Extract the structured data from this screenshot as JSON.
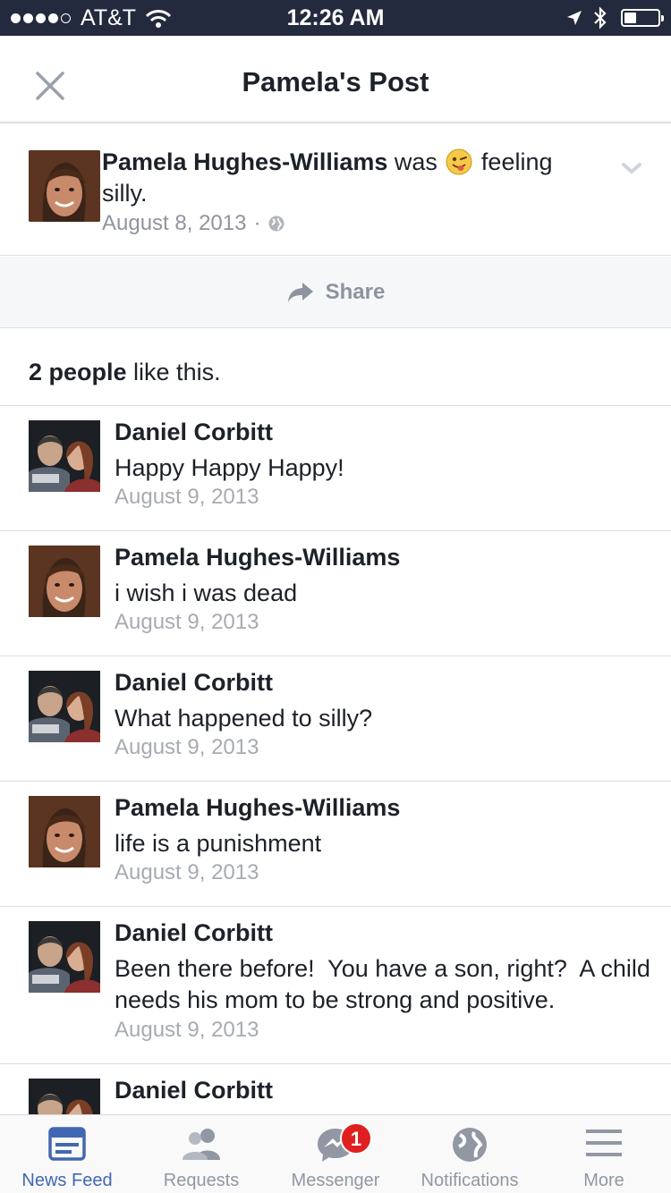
{
  "status_bar": {
    "carrier": "AT&T",
    "time": "12:26 AM",
    "signal_filled": 4,
    "signal_total": 5,
    "battery_level": 0.35
  },
  "header": {
    "title": "Pamela's Post"
  },
  "post": {
    "author": "Pamela Hughes-Williams",
    "was": "was",
    "feeling": "feeling",
    "mood": "silly.",
    "date": "August 8, 2013",
    "separator": "·",
    "emoji": "winking-tongue-emoji",
    "privacy_icon": "globe-icon"
  },
  "share": {
    "label": "Share"
  },
  "likes": {
    "count_text": "2 people",
    "suffix": "like this."
  },
  "comments": [
    {
      "author": "Daniel Corbitt",
      "text": "Happy Happy Happy!",
      "date": "August 9, 2013"
    },
    {
      "author": "Pamela Hughes-Williams",
      "text": "i wish i was dead",
      "date": "August 9, 2013"
    },
    {
      "author": "Daniel Corbitt",
      "text": "What happened to silly?",
      "date": "August 9, 2013"
    },
    {
      "author": "Pamela Hughes-Williams",
      "text": "life is a punishment",
      "date": "August 9, 2013"
    },
    {
      "author": "Daniel Corbitt",
      "text": "Been there before!  You have a son, right?  A child needs his mom to be strong and positive.",
      "date": "August 9, 2013"
    },
    {
      "author": "Daniel Corbitt",
      "text": "",
      "date": ""
    }
  ],
  "tabs": [
    {
      "label": "News Feed",
      "icon": "news-feed-icon",
      "active": true
    },
    {
      "label": "Requests",
      "icon": "requests-icon",
      "active": false
    },
    {
      "label": "Messenger",
      "icon": "messenger-icon",
      "active": false,
      "badge": "1"
    },
    {
      "label": "Notifications",
      "icon": "globe-icon",
      "active": false
    },
    {
      "label": "More",
      "icon": "menu-icon",
      "active": false
    }
  ],
  "colors": {
    "accent": "#4267b2",
    "status_bar_bg": "#232a3d",
    "badge": "#e02020",
    "muted_text": "#90949c"
  }
}
